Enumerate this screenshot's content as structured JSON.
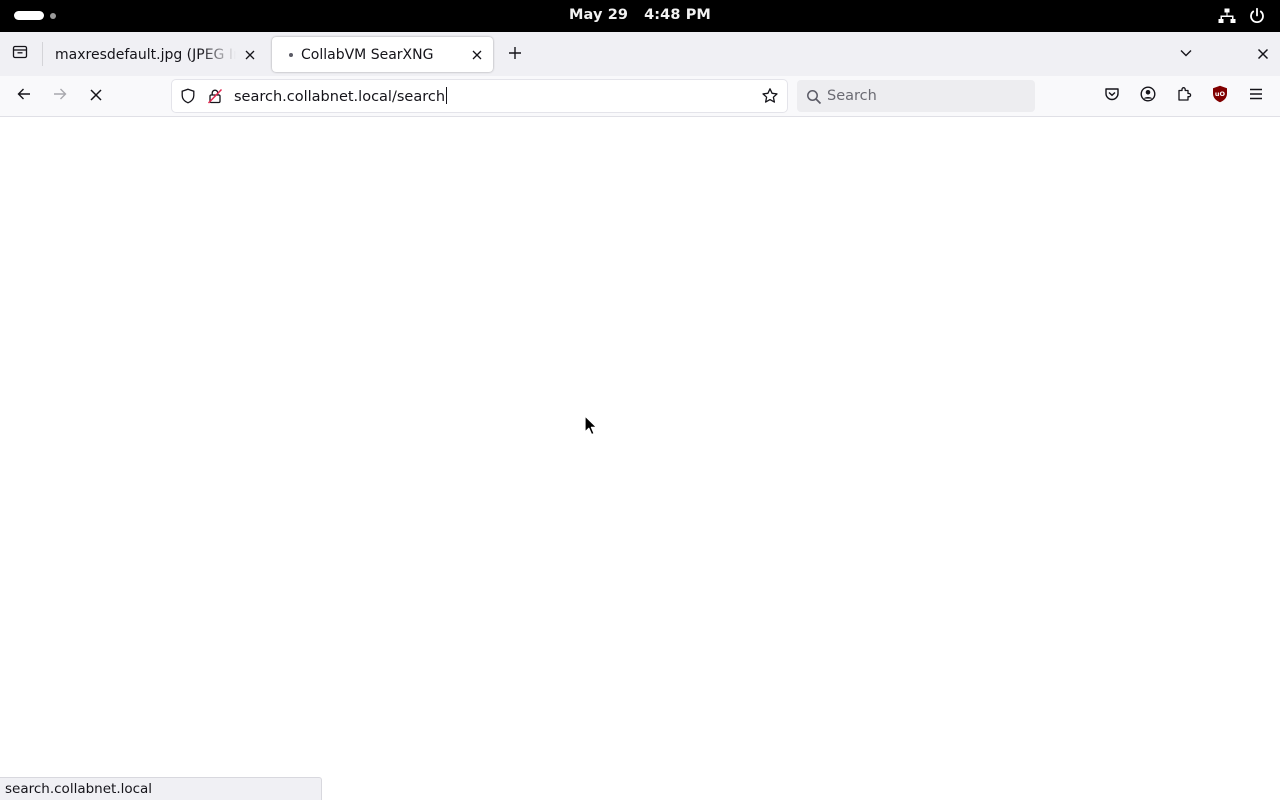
{
  "system_bar": {
    "date": "May 29",
    "time": "4:48 PM",
    "icons": [
      "activities-indicator",
      "network-icon",
      "power-icon"
    ]
  },
  "tabs": [
    {
      "title": "maxresdefault.jpg (JPEG Ima",
      "active": false
    },
    {
      "title": "CollabVM SearXNG",
      "active": true,
      "loading": true
    }
  ],
  "toolbar": {
    "url": "search.collabnet.local/search",
    "search_placeholder": "Search",
    "icons": [
      "back-icon",
      "forward-icon",
      "stop-icon",
      "shield-icon",
      "insecure-lock-icon",
      "bookmark-star-icon",
      "pocket-icon",
      "account-icon",
      "extensions-icon",
      "ublock-icon",
      "menu-icon"
    ]
  },
  "status_bar": {
    "text": "search.collabnet.local"
  },
  "colors": {
    "system_bar": "#000000",
    "tab_strip": "#f0f0f4",
    "toolbar": "#f9f9fb",
    "ublock_red": "#800000"
  }
}
